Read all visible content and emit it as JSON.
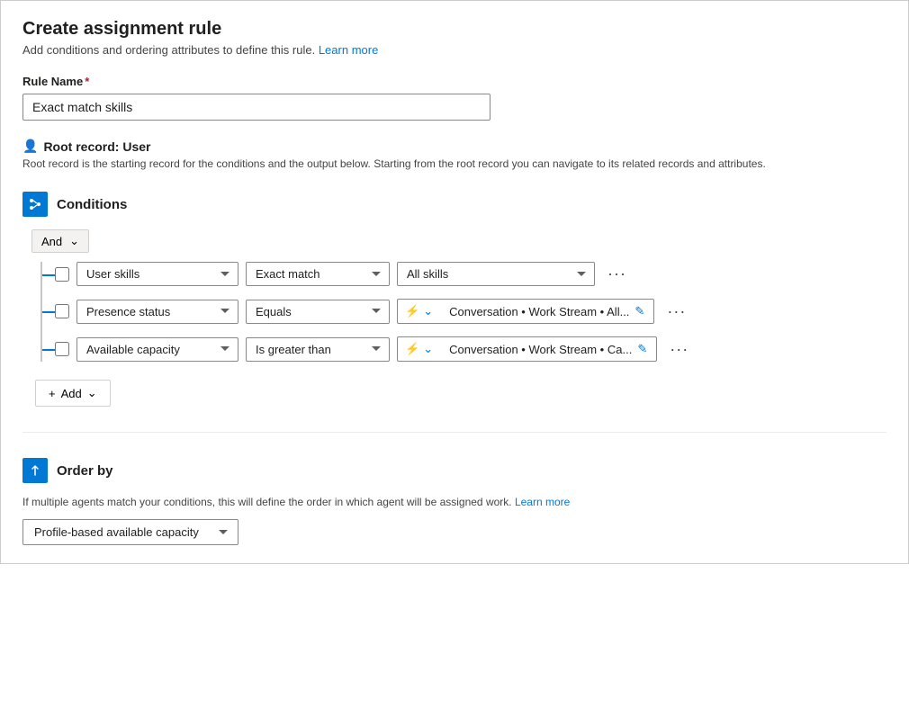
{
  "header": {
    "title": "Create assignment rule",
    "subtitle": "Add conditions and ordering attributes to define this rule.",
    "learn_more_label": "Learn more"
  },
  "rule_name": {
    "label": "Rule Name",
    "value": "Exact match skills"
  },
  "root_record": {
    "label": "Root record: User",
    "description": "Root record is the starting record for the conditions and the output below. Starting from the root record you can navigate to its related records and attributes."
  },
  "conditions": {
    "section_title": "Conditions",
    "and_label": "And",
    "rows": [
      {
        "field": "User skills",
        "operator": "Exact match",
        "value": "All skills",
        "has_lightning": false
      },
      {
        "field": "Presence status",
        "operator": "Equals",
        "value": "Conversation • Work Stream • All...",
        "has_lightning": true
      },
      {
        "field": "Available capacity",
        "operator": "Is greater than",
        "value": "Conversation • Work Stream • Ca...",
        "has_lightning": true
      }
    ],
    "add_label": "Add"
  },
  "order_by": {
    "section_title": "Order by",
    "description": "If multiple agents match your conditions, this will define the order in which agent will be assigned work.",
    "learn_more_label": "Learn more",
    "value": "Profile-based available capacity"
  },
  "icons": {
    "conditions_icon": "⚡",
    "order_by_icon": "↑",
    "lightning": "⚡",
    "pencil": "✏",
    "plus": "+",
    "ellipsis": "···",
    "user_icon": "👤"
  }
}
